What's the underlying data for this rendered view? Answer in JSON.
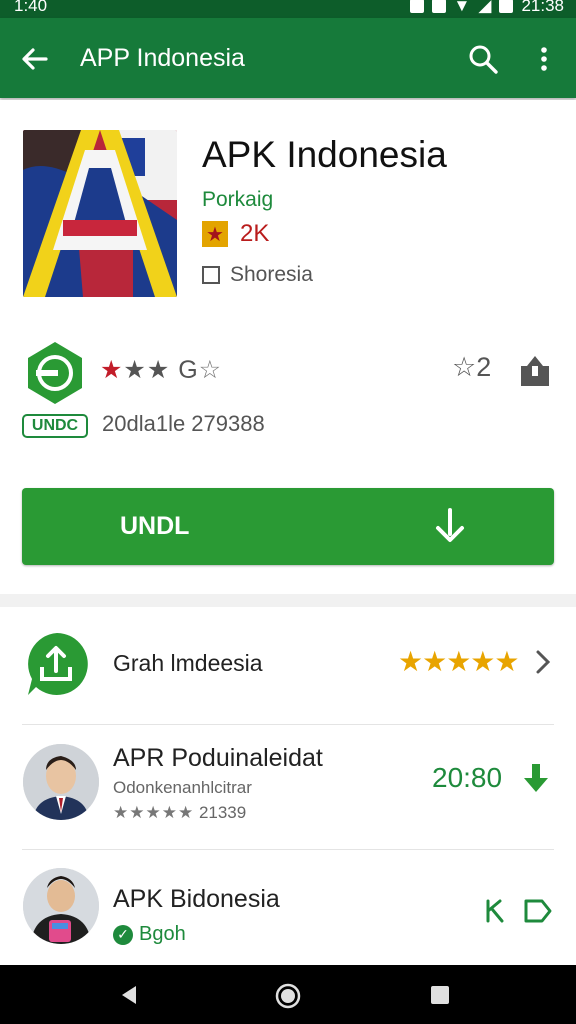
{
  "status_bar": {
    "time": "1:40",
    "right_text": "21:38"
  },
  "app_bar": {
    "title": "APP Indonesia"
  },
  "app": {
    "name": "APK Indonesia",
    "developer": "Porkaig",
    "badge_text": "2K",
    "category": "Shoresia"
  },
  "stats": {
    "badge": "UNDC",
    "rating_glyph": "G",
    "downloads_text": "20dla1le 279388",
    "wish_count": "2"
  },
  "install": {
    "label": "UNDL"
  },
  "list": [
    {
      "title": "Grah lmdeesia",
      "stars": "★★★★★"
    },
    {
      "title": "APR Poduinaleidat",
      "subtitle": "Odonkenanhlcitrar",
      "meta": "21339",
      "meta_stars": "★★★★★",
      "price": "20:80"
    },
    {
      "title": "APK Bidonesia",
      "subtitle": "Bgoh"
    }
  ],
  "colors": {
    "primary": "#167a3a",
    "accent": "#2a9a34",
    "star": "#e8a400"
  },
  "icons": {
    "back": "arrow-left-icon",
    "search": "search-icon",
    "more": "more-vert-icon",
    "share": "share-icon",
    "wish": "star-outline-icon",
    "download": "download-icon"
  }
}
